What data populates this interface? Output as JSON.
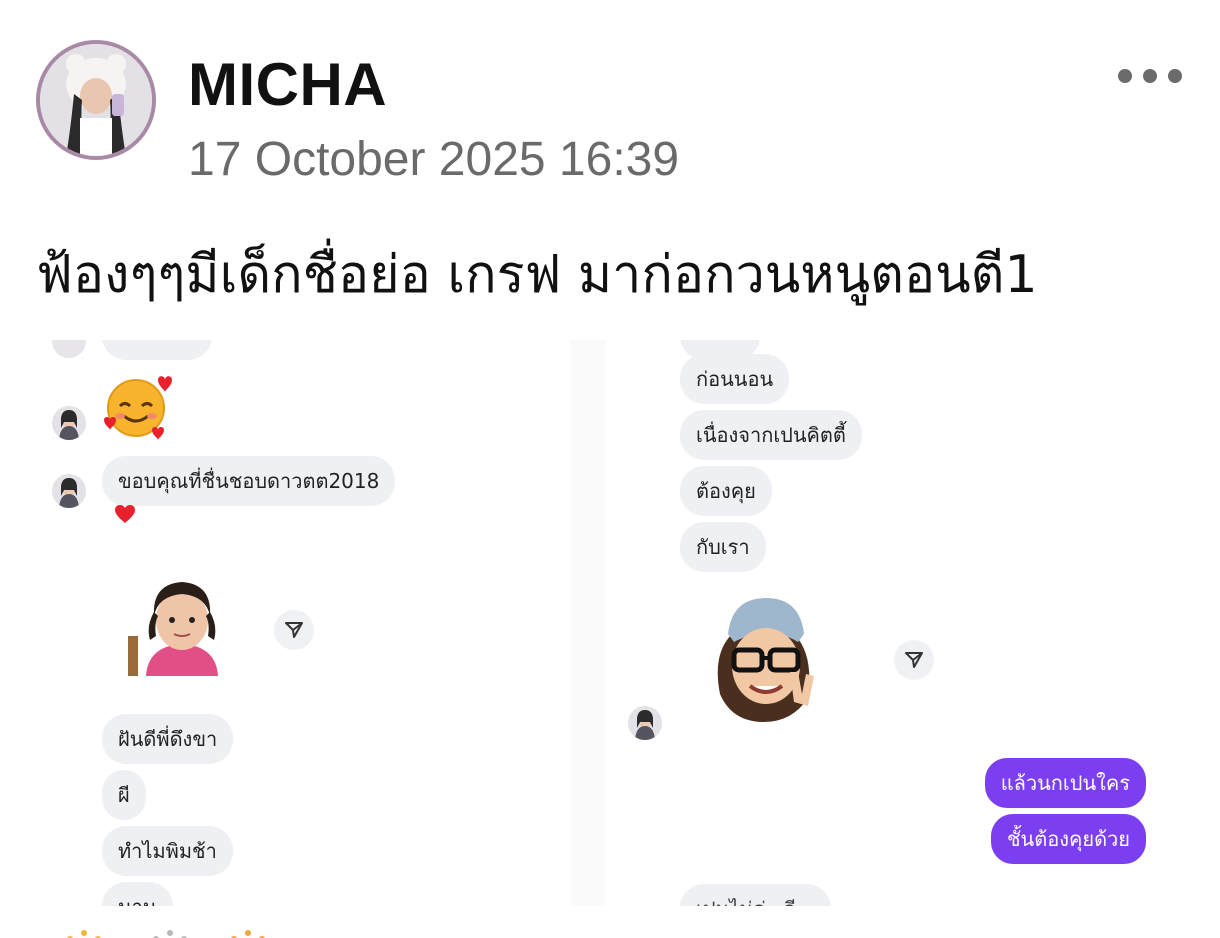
{
  "post": {
    "author": "MICHA",
    "timestamp": "17 October 2025 16:39",
    "caption": "ฟ้องๆๆมีเด็กชื่อย่อ เกรฟ มาก่อกวนหนูตอนตี1"
  },
  "icons": {
    "more": "more-horizontal-icon",
    "share": "share-arrow-icon",
    "emoji": "smiling-face-with-hearts-icon",
    "heart": "heart-icon"
  },
  "chat_left": {
    "messages": [
      "ขอบคุณที่ชื่นชอบดาวตต2018",
      "ฝันดีพี่ดึงขา",
      "ผี",
      "ทำไมพิมช้า",
      "นาน"
    ]
  },
  "chat_right": {
    "messages": [
      "ก่อนนอน",
      "เนื่องจากเปนคิตตี้",
      "ต้องคุย",
      "กับเรา"
    ],
    "sent": [
      "แล้วนกเปนใคร",
      "ชั้นต้องคุยด้วย"
    ],
    "partial": "เปนไม่ค่ะ ดี..."
  },
  "colors": {
    "sent_bubble": "#7b3ef0",
    "received_bubble": "#eef0f4",
    "avatar_border": "#a98aa6",
    "timestamp": "#6a6a6a"
  }
}
